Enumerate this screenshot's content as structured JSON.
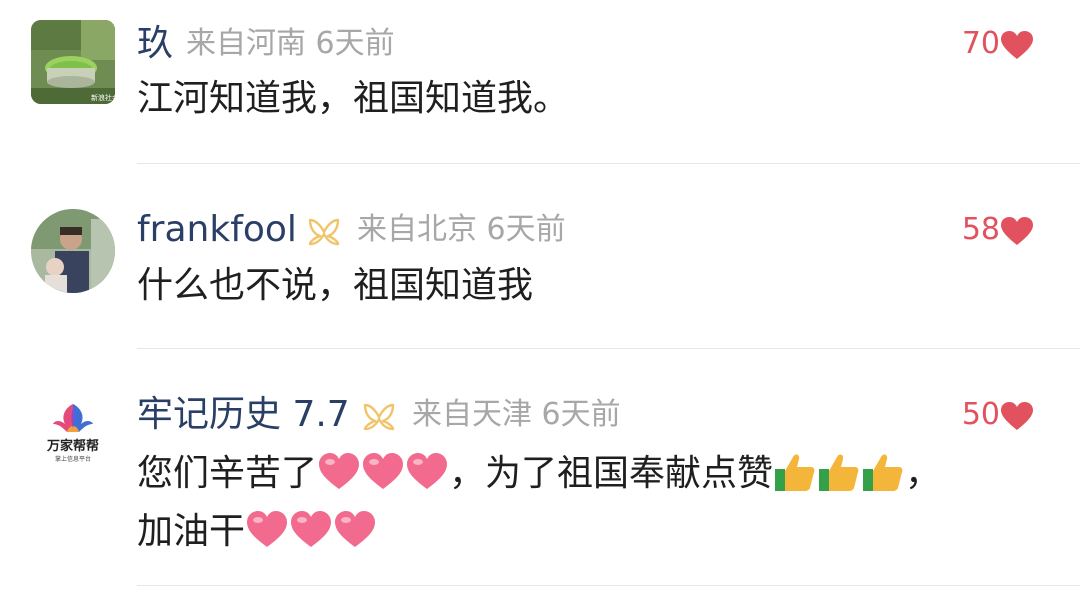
{
  "comments": [
    {
      "username": "玖",
      "location_time": "来自河南 6天前",
      "likes": "70",
      "text": "江河知道我，祖国知道我。",
      "avatar_watermark": "新浪社会"
    },
    {
      "username": "frankfool",
      "location_time": "来自北京 6天前",
      "likes": "58",
      "text": "什么也不说，祖国知道我"
    },
    {
      "username": "牢记历史 7.7",
      "location_time": "来自天津 6天前",
      "likes": "50",
      "text_part1": "您们辛苦了",
      "text_part2": "，为了祖国奉献点赞",
      "text_part3": "，",
      "text_line2": "加油干",
      "avatar_logo_text": "万家帮帮",
      "avatar_logo_subtext": "掌上信息平台"
    }
  ],
  "colors": {
    "username": "#2b3f66",
    "meta": "#a7a7a7",
    "likes": "#e2525e",
    "text": "#1f1f1f",
    "divider": "#e6e6e6"
  },
  "icons": [
    "heart-like-icon",
    "vip-badge-icon",
    "red-heart-emoji",
    "thumbs-up-emoji"
  ]
}
